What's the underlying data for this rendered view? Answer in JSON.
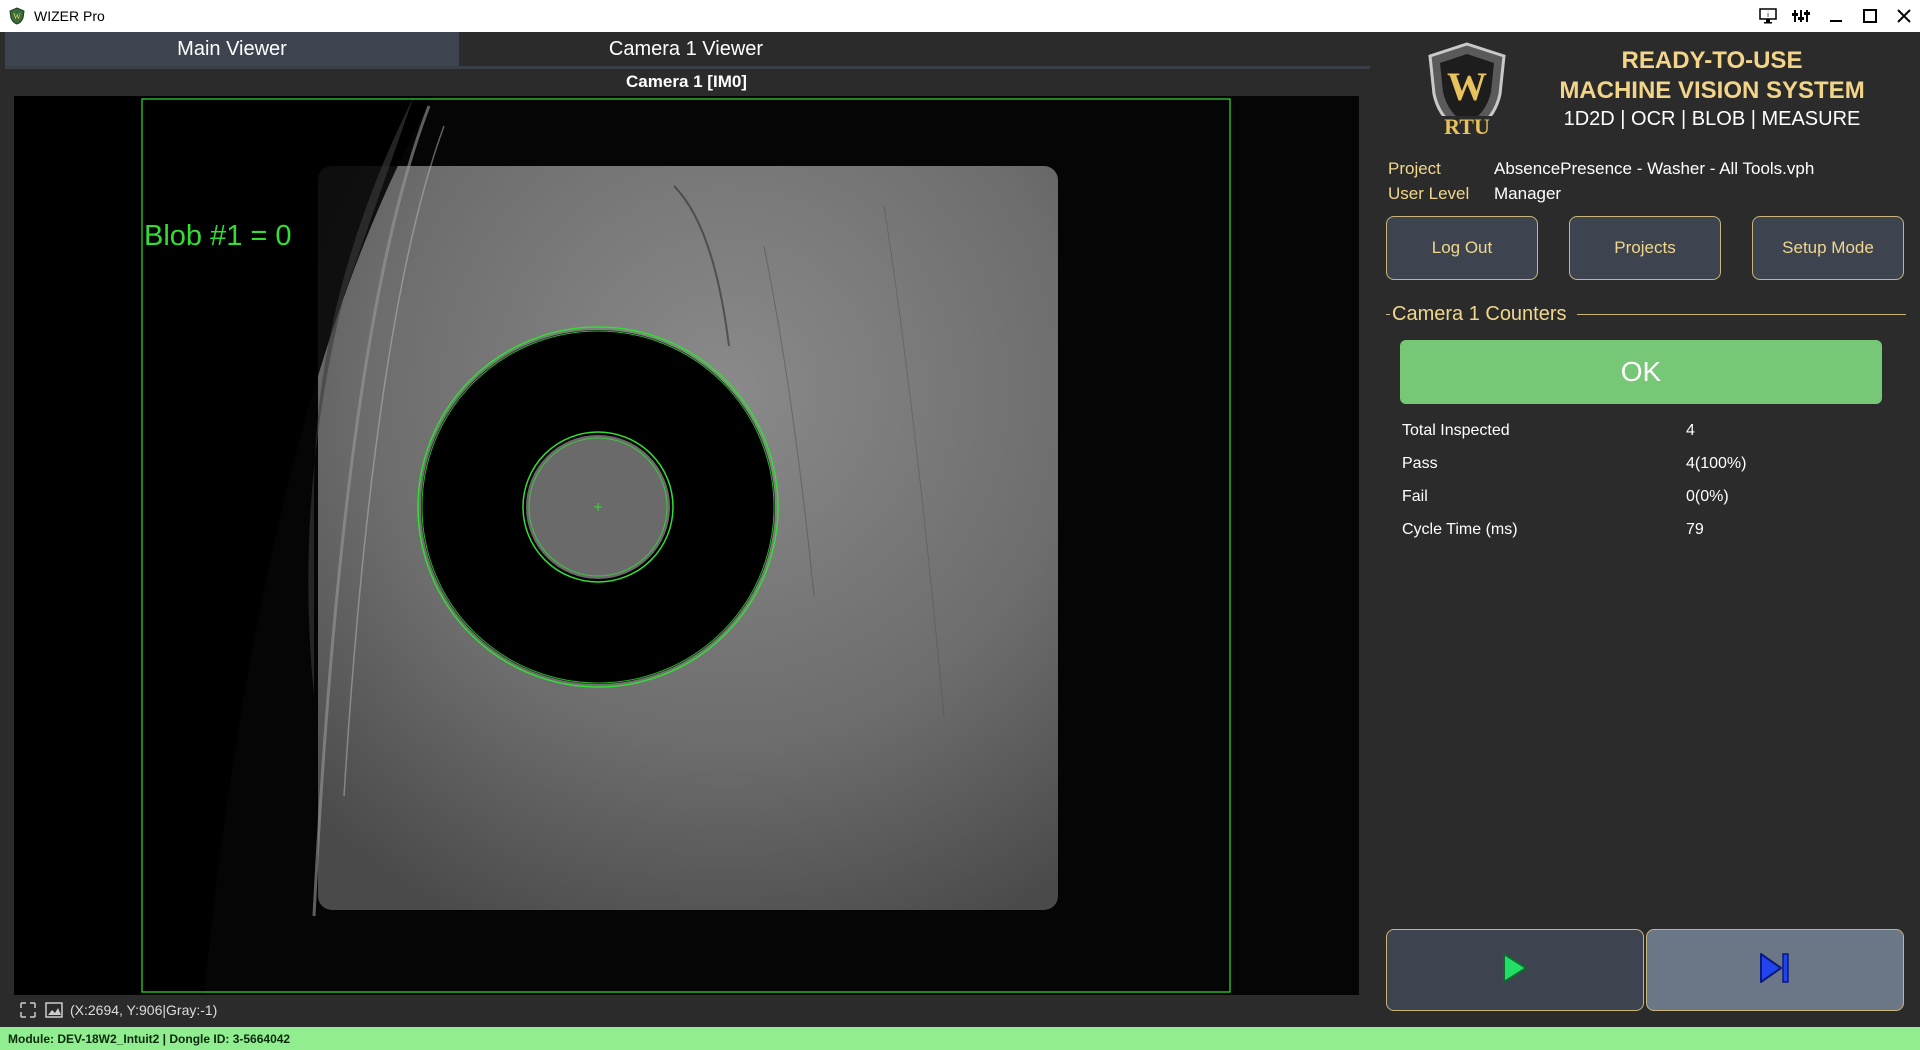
{
  "window": {
    "title": "WIZER Pro",
    "controls": [
      "monitor-icon",
      "settings-icon",
      "minimize-icon",
      "maximize-icon",
      "close-icon"
    ]
  },
  "tabs": [
    {
      "label": "Main Viewer",
      "active": true
    },
    {
      "label": "Camera 1 Viewer",
      "active": false
    }
  ],
  "viewer": {
    "camera_label": "Camera 1  [IM0]",
    "overlay_text": "Blob #1 = 0",
    "coords": "(X:2694, Y:906|Gray:-1)",
    "overlay_color": "#33dd33"
  },
  "module_bar": "Module: DEV-18W2_Intuit2 | Dongle ID: 3-5664042",
  "brand": {
    "logo_text": "RTU",
    "line1": "READY-TO-USE",
    "line2": "MACHINE VISION SYSTEM",
    "tools": "1D2D | OCR | BLOB | MEASURE"
  },
  "info": {
    "project_label": "Project",
    "project_value": "AbsencePresence - Washer - All Tools.vph",
    "user_label": "User Level",
    "user_value": "Manager"
  },
  "buttons": {
    "logout": "Log Out",
    "projects": "Projects",
    "setup": "Setup Mode"
  },
  "counters": {
    "title": "Camera 1 Counters",
    "status": "OK",
    "status_color": "#76c776",
    "rows": [
      {
        "label": "Total Inspected",
        "value": "4"
      },
      {
        "label": "Pass",
        "value": "4(100%)"
      },
      {
        "label": "Fail",
        "value": "0(0%)"
      },
      {
        "label": "Cycle Time (ms)",
        "value": "79"
      }
    ]
  },
  "controls": {
    "run_icon": "play-icon",
    "step_icon": "step-forward-icon"
  }
}
